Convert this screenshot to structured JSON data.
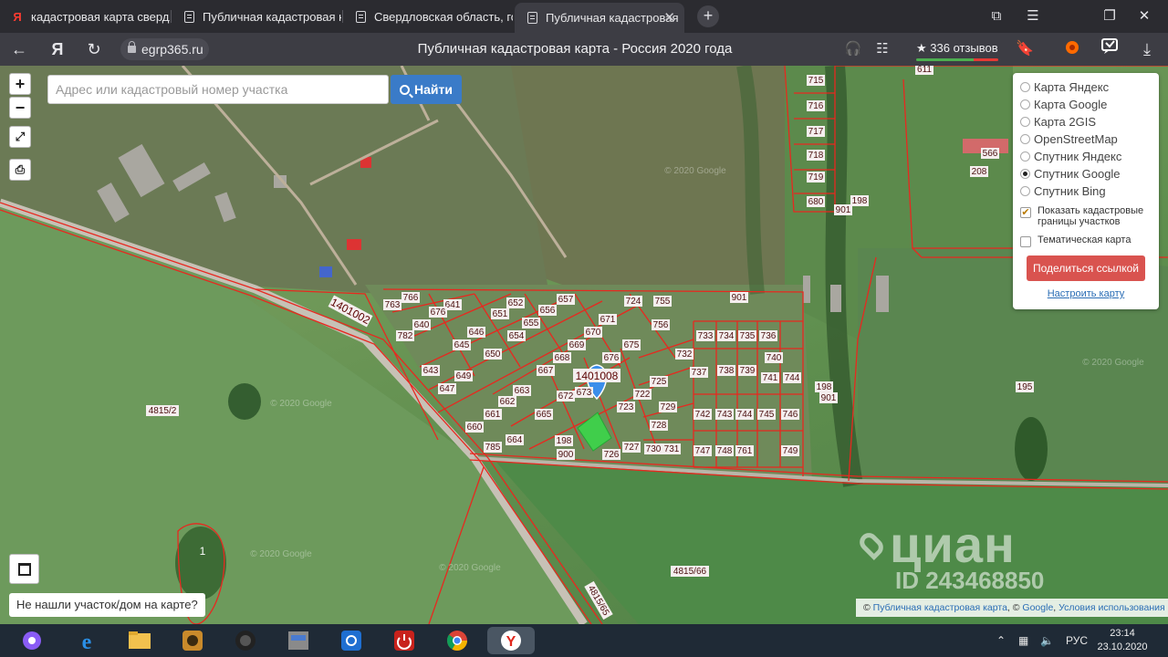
{
  "tabs": [
    {
      "title": "кадастровая карта свердл",
      "icon": "yandex-logo-icon",
      "active": false
    },
    {
      "title": "Публичная кадастровая к",
      "icon": "document-icon",
      "active": false
    },
    {
      "title": "Свердловская область, гор",
      "icon": "document-icon",
      "active": false
    },
    {
      "title": "Публичная кадастровая",
      "icon": "document-icon",
      "active": true
    }
  ],
  "browser": {
    "back_glyph": "←",
    "yandex_glyph": "Я",
    "url": "egrp365.ru",
    "page_title": "Публичная кадастровая карта - Россия 2020 года",
    "reviews": "★ 336 отзывов"
  },
  "map": {
    "zoom_in": "+",
    "zoom_out": "−",
    "search_placeholder": "Адрес или кадастровый номер участка",
    "search_button": "Найти",
    "not_found": "Не нашли участок/дом на карте?",
    "layers": [
      {
        "label": "Карта Яндекс",
        "selected": false
      },
      {
        "label": "Карта Google",
        "selected": false
      },
      {
        "label": "Карта 2GIS",
        "selected": false
      },
      {
        "label": "OpenStreetMap",
        "selected": false
      },
      {
        "label": "Спутник Яндекс",
        "selected": false
      },
      {
        "label": "Спутник Google",
        "selected": true
      },
      {
        "label": "Спутник Bing",
        "selected": false
      }
    ],
    "show_borders_label": "Показать кадастровые границы участков",
    "show_borders_checked": true,
    "thematic_label": "Тематическая карта",
    "thematic_checked": false,
    "share_button": "Поделиться ссылкой",
    "configure_link": "Настроить карту",
    "attribution": {
      "copyright": "©",
      "link1": "Публичная кадастровая карта",
      "sep": ", ©",
      "link2": "Google",
      "sep2": ",",
      "link3": "Условия использования"
    },
    "quarter_labels": [
      "1401002",
      "1401008"
    ],
    "parcel_labels": [
      "715",
      "716",
      "717",
      "718",
      "719",
      "680",
      "901",
      "198",
      "566",
      "208",
      "611",
      "766",
      "763",
      "641",
      "640",
      "782",
      "676",
      "646",
      "645",
      "650",
      "643",
      "649",
      "647",
      "652",
      "651",
      "655",
      "654",
      "656",
      "657",
      "724",
      "755",
      "671",
      "670",
      "669",
      "675",
      "676",
      "668",
      "667",
      "756",
      "732",
      "733",
      "734",
      "735",
      "736",
      "740",
      "737",
      "738",
      "739",
      "741",
      "744",
      "665",
      "663",
      "661",
      "662",
      "664",
      "660",
      "785",
      "672",
      "673",
      "725",
      "723",
      "722",
      "729",
      "728",
      "726",
      "727",
      "730",
      "731",
      "742",
      "743",
      "744",
      "745",
      "746",
      "747",
      "748",
      "749",
      "761",
      "198",
      "900",
      "901",
      "195",
      "4815/2",
      "4815/66",
      "4815/65",
      "1",
      "198",
      "901"
    ],
    "watermark_logo": "циан",
    "watermark_id": "ID 243468850",
    "google_copyright": "© 2020 Google",
    "pin_color": "#3b8eea",
    "border_color": "#e8281f"
  },
  "taskbar": {
    "language": "РУС",
    "time": "23:14",
    "date": "23.10.2020"
  }
}
